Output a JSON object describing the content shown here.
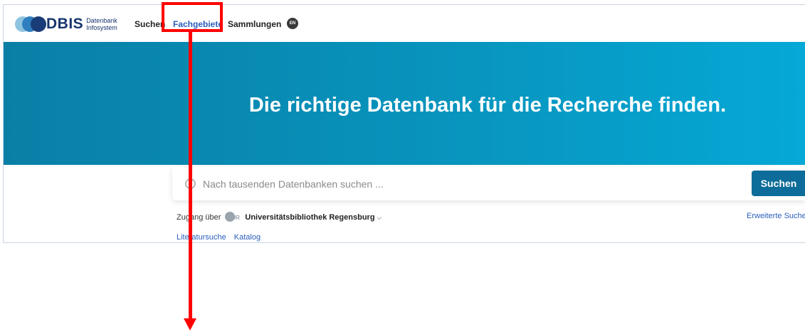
{
  "logo": {
    "brand": "DBIS",
    "sub1": "Datenbank",
    "sub2": "Infosystem"
  },
  "nav": {
    "suchen": "Suchen",
    "fachgebiete": "Fachgebiete",
    "sammlungen": "Sammlungen",
    "lang": "EN"
  },
  "hero": {
    "title": "Die richtige Datenbank für die Recherche finden."
  },
  "search": {
    "placeholder": "Nach tausenden Datenbanken suchen ...",
    "button": "Suchen"
  },
  "access": {
    "prefix": "Zugang über",
    "badge": "UR",
    "library": "Universitätsbibliothek Regensburg"
  },
  "advanced_search": "Erweiterte Suche",
  "links": {
    "literature": "Literatursuche",
    "catalog": "Katalog"
  },
  "annotation": {
    "highlight_color": "#ff0000",
    "target": "Fachgebiete"
  }
}
